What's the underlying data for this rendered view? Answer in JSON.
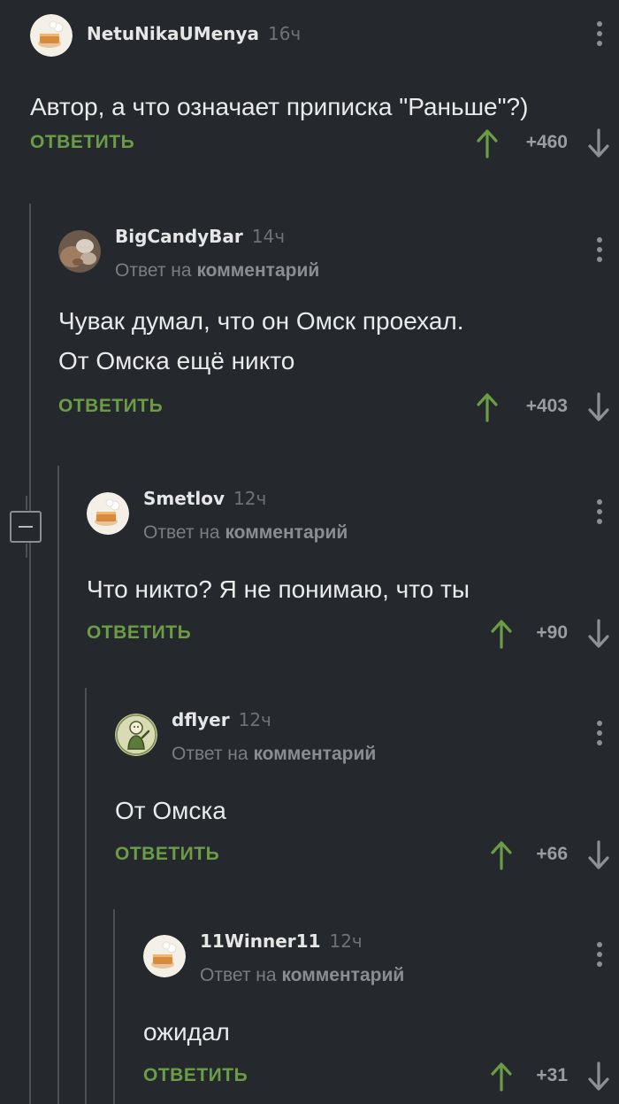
{
  "thread": {
    "reply_label": "ОТВЕТИТЬ",
    "reply_to_prefix": "Ответ на",
    "reply_to_link": "комментарий",
    "colors": {
      "background": "#25282c",
      "reply_button": "#6a9d45",
      "upvote_arrow": "#6a9d45",
      "downvote_arrow": "#8d9195"
    },
    "icons": {
      "upvote": "arrow-up-icon",
      "downvote": "arrow-down-icon",
      "more": "more-vertical-icon",
      "collapse": "minus-square-icon"
    },
    "comments": [
      {
        "author": "NetuNikaUMenya",
        "time": "16ч",
        "avatar": "default-cake-avatar",
        "lines": [
          "Автор, а что означает приписка \"Раньше\"?)"
        ],
        "score": "+460"
      },
      {
        "author": "BigCandyBar",
        "time": "14ч",
        "avatar": "photo-avatar",
        "lines": [
          "Чувак думал, что он Омск проехал.",
          "От Омска ещё никто"
        ],
        "score": "+403"
      },
      {
        "author": "Smetlov",
        "time": "12ч",
        "avatar": "default-cake-avatar",
        "lines": [
          "Что никто? Я не понимаю, что ты"
        ],
        "score": "+90"
      },
      {
        "author": "dflyer",
        "time": "12ч",
        "avatar": "vault-boy-avatar",
        "lines": [
          "От Омска"
        ],
        "score": "+66"
      },
      {
        "author": "11Winner11",
        "time": "12ч",
        "avatar": "default-cake-avatar",
        "lines": [
          "ожидал"
        ],
        "score": "+31"
      }
    ]
  }
}
